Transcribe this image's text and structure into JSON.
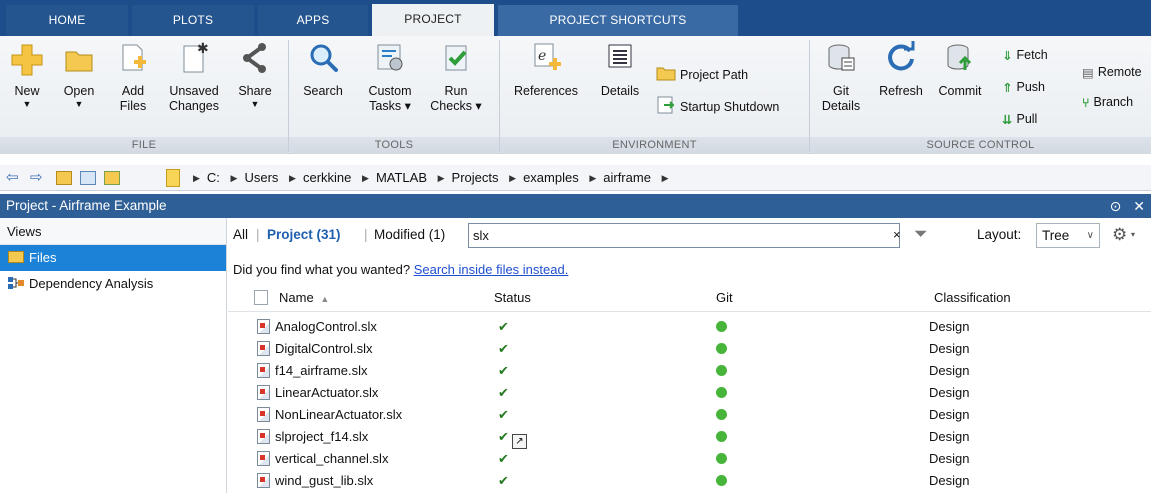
{
  "tabs": [
    {
      "label": "HOME"
    },
    {
      "label": "PLOTS"
    },
    {
      "label": "APPS"
    },
    {
      "label": "PROJECT"
    },
    {
      "label": "PROJECT SHORTCUTS"
    }
  ],
  "ribbon": {
    "file": {
      "section": "FILE",
      "new": "New",
      "open": "Open",
      "add": "Add",
      "add2": "Files",
      "unsaved": "Unsaved",
      "unsaved2": "Changes",
      "share": "Share"
    },
    "tools": {
      "section": "TOOLS",
      "search": "Search",
      "custom": "Custom",
      "custom2": "Tasks ▾",
      "run": "Run",
      "run2": "Checks ▾"
    },
    "environment": {
      "section": "ENVIRONMENT",
      "references": "References",
      "details": "Details",
      "project_path": "Project Path",
      "startup": "Startup Shutdown"
    },
    "source": {
      "section": "SOURCE CONTROL",
      "git": "Git",
      "git2": "Details",
      "refresh": "Refresh",
      "commit": "Commit",
      "fetch": "Fetch",
      "push": "Push",
      "pull": "Pull",
      "remote": "Remote",
      "branches": "Branch"
    }
  },
  "address": {
    "path": [
      "C:",
      "Users",
      "cerkkine",
      "MATLAB",
      "Projects",
      "examples",
      "airframe"
    ]
  },
  "panel": {
    "title": "Project - Airframe Example"
  },
  "sidebar": {
    "title": "Views",
    "items": [
      {
        "label": "Files"
      },
      {
        "label": "Dependency Analysis"
      }
    ]
  },
  "filters": {
    "all": "All",
    "project": "Project (31)",
    "modified": "Modified (1)",
    "search_value": "slx",
    "layout_label": "Layout:",
    "layout_value": "Tree"
  },
  "hint": {
    "text": "Did you find what you wanted?",
    "link": "Search inside files instead."
  },
  "columns": {
    "name": "Name",
    "status": "Status",
    "git": "Git",
    "classification": "Classification"
  },
  "files": [
    {
      "name": "AnalogControl.slx",
      "status": "✔",
      "classification": "Design"
    },
    {
      "name": "DigitalControl.slx",
      "status": "✔",
      "classification": "Design"
    },
    {
      "name": "f14_airframe.slx",
      "status": "✔",
      "classification": "Design"
    },
    {
      "name": "LinearActuator.slx",
      "status": "✔",
      "classification": "Design"
    },
    {
      "name": "NonLinearActuator.slx",
      "status": "✔",
      "classification": "Design"
    },
    {
      "name": "slproject_f14.slx",
      "status": "✔",
      "classification": "Design"
    },
    {
      "name": "vertical_channel.slx",
      "status": "✔",
      "classification": "Design"
    },
    {
      "name": "wind_gust_lib.slx",
      "status": "✔",
      "classification": "Design"
    }
  ],
  "colors": {
    "tabbar": "#1e4d8c",
    "panel_header": "#2f5f97",
    "selection": "#1b82d7",
    "git_ok": "#47b53a",
    "link": "#1f4fd1"
  }
}
